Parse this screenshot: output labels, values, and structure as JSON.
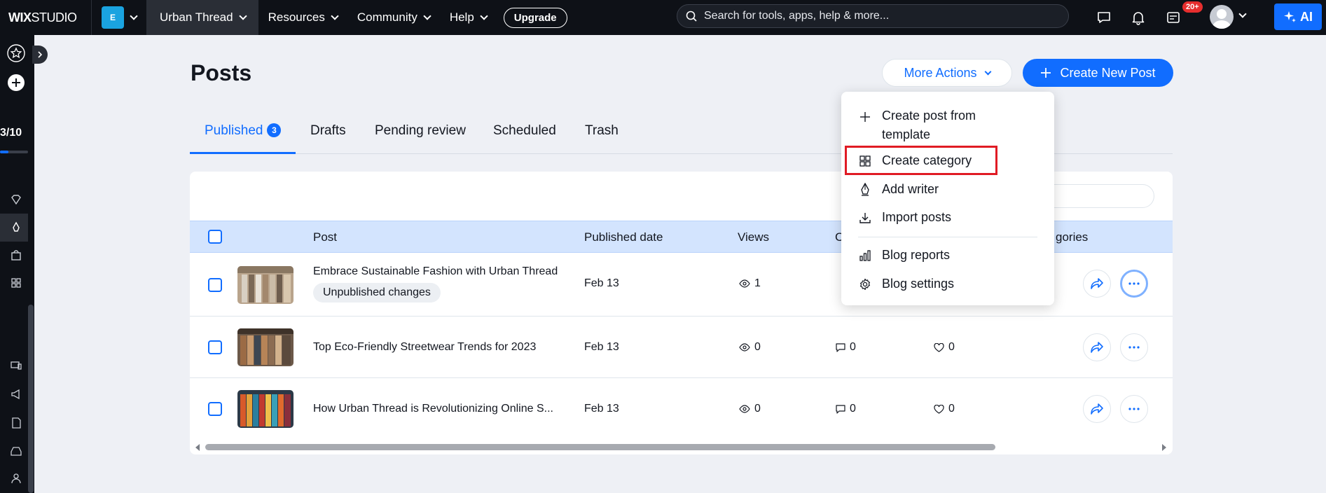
{
  "topbar": {
    "logo_bold": "WIX",
    "logo_light": "STUDIO",
    "site_badge": "E",
    "site_name": "Urban Thread",
    "nav": [
      "Resources",
      "Community",
      "Help"
    ],
    "upgrade": "Upgrade",
    "search_placeholder": "Search for tools, apps, help & more...",
    "notif_badge": "20+",
    "ai_label": "AI"
  },
  "sidebar": {
    "progress": "3/10",
    "progress_fraction": 0.3
  },
  "page": {
    "title": "Posts",
    "more_actions": "More Actions",
    "create_new_post": "Create New Post"
  },
  "tabs": {
    "published": "Published",
    "published_count": "3",
    "drafts": "Drafts",
    "pending": "Pending review",
    "scheduled": "Scheduled",
    "trash": "Trash"
  },
  "table": {
    "headers": {
      "post": "Post",
      "published_date": "Published date",
      "views": "Views",
      "comments_partial": "C",
      "categories_partial": "gories"
    },
    "rows": [
      {
        "title": "Embrace Sustainable Fashion with Urban Thread",
        "tag": "Unpublished changes",
        "date": "Feb 13",
        "views": "1",
        "comments": "",
        "likes": ""
      },
      {
        "title": "Top Eco-Friendly Streetwear Trends for 2023",
        "date": "Feb 13",
        "views": "0",
        "comments": "0",
        "likes": "0"
      },
      {
        "title": "How Urban Thread is Revolutionizing Online S...",
        "date": "Feb 13",
        "views": "0",
        "comments": "0",
        "likes": "0"
      }
    ]
  },
  "dropdown": {
    "items": [
      {
        "label_line1": "Create post from",
        "label_line2": "template",
        "icon": "plus-icon"
      },
      {
        "label": "Create category",
        "icon": "grid-icon"
      },
      {
        "label": "Add writer",
        "icon": "pen-nib-icon"
      },
      {
        "label": "Import posts",
        "icon": "download-icon"
      },
      {
        "label": "Blog reports",
        "icon": "bar-chart-icon"
      },
      {
        "label": "Blog settings",
        "icon": "gear-icon"
      }
    ]
  },
  "colors": {
    "accent": "#116dff",
    "topbar_bg": "#0e1117",
    "highlight": "#e01b24"
  }
}
